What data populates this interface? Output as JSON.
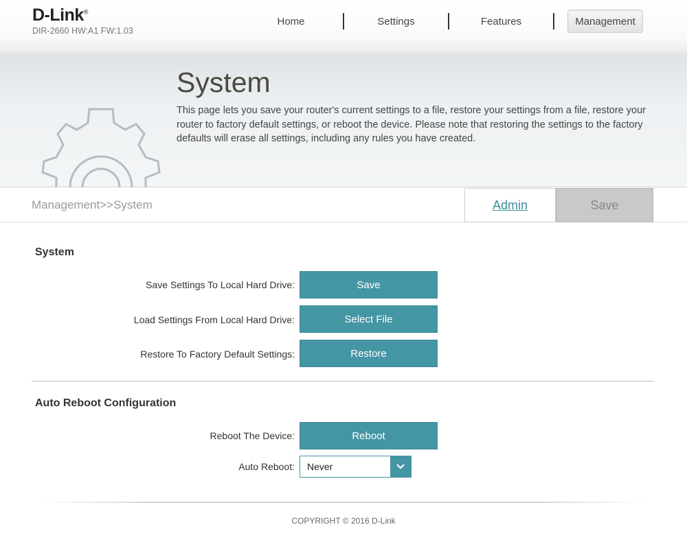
{
  "header": {
    "logo": "D-Link",
    "logo_mark": "®",
    "model": "DIR-2660 HW:A1 FW:1.03"
  },
  "nav": {
    "items": [
      {
        "label": "Home"
      },
      {
        "label": "Settings"
      },
      {
        "label": "Features"
      },
      {
        "label": "Management"
      }
    ],
    "active": "Management"
  },
  "banner": {
    "title": "System",
    "description": "This page lets you save your router's current settings to a file, restore your settings from a file, restore your router to factory default settings, or reboot the device. Please note that restoring the settings to the factory defaults will erase all settings, including any rules you have created.",
    "icon": "gear-icon"
  },
  "breadcrumb": {
    "path": "Management>>System",
    "admin_label": "Admin",
    "save_label": "Save"
  },
  "system": {
    "title": "System",
    "rows": [
      {
        "label": "Save Settings To Local Hard Drive:",
        "button": "Save"
      },
      {
        "label": "Load Settings From Local Hard Drive:",
        "button": "Select File"
      },
      {
        "label": "Restore To Factory Default Settings:",
        "button": "Restore"
      }
    ]
  },
  "auto_reboot": {
    "title": "Auto Reboot Configuration",
    "reboot_label": "Reboot The Device:",
    "reboot_button": "Reboot",
    "auto_label": "Auto Reboot:",
    "auto_value": "Never"
  },
  "footer": {
    "copyright": "COPYRIGHT © 2016 D-Link"
  },
  "colors": {
    "accent": "#4596a4",
    "link": "#3b8c9c",
    "disabled_button": "#c9c9c9"
  }
}
